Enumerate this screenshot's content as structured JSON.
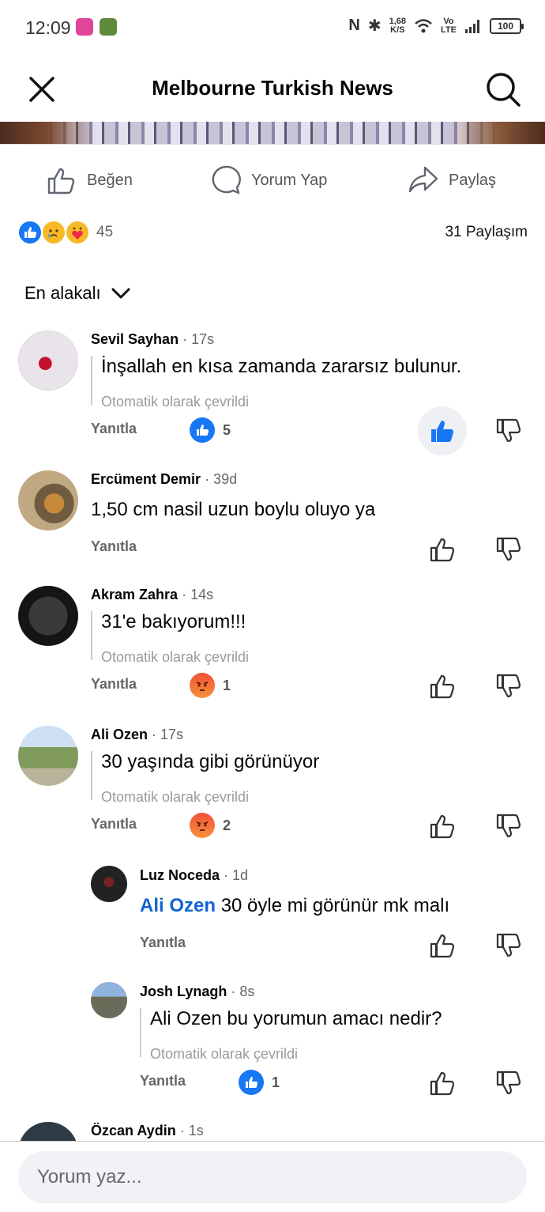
{
  "status_bar": {
    "time": "12:09",
    "net_speed": "1,68",
    "net_unit": "K/S",
    "network_top": "Vo",
    "network_bottom": "LTE",
    "battery": "100"
  },
  "header": {
    "title": "Melbourne Turkish News"
  },
  "actions": {
    "like": "Beğen",
    "comment": "Yorum Yap",
    "share": "Paylaş"
  },
  "stats": {
    "reaction_count": "45",
    "shares": "31 Paylaşım"
  },
  "sort": {
    "label": "En alakalı"
  },
  "comments": [
    {
      "name": "Sevil Sayhan",
      "time": "· 17s",
      "text": "İnşallah en kısa zamanda zararsız bulunur.",
      "translated": "Otomatik olarak çevrildi",
      "reply": "Yanıtla",
      "reaction_count": "5"
    },
    {
      "name": "Ercüment Demir",
      "time": "· 39d",
      "text": "1,50 cm nasil uzun boylu oluyo ya",
      "reply": "Yanıtla"
    },
    {
      "name": "Akram Zahra",
      "time": "· 14s",
      "text": "31'e bakıyorum!!!",
      "translated": "Otomatik olarak çevrildi",
      "reply": "Yanıtla",
      "reaction_count": "1"
    },
    {
      "name": "Ali Ozen",
      "time": "· 17s",
      "text": "30 yaşında gibi görünüyor",
      "translated": "Otomatik olarak çevrildi",
      "reply": "Yanıtla",
      "reaction_count": "2"
    },
    {
      "name": "Luz Noceda",
      "time": "· 1d",
      "mention": "Ali Ozen",
      "text": "30 öyle mi görünür mk malı",
      "reply": "Yanıtla"
    },
    {
      "name": "Josh Lynagh",
      "time": "· 8s",
      "text": "Ali Ozen bu yorumun amacı nedir?",
      "translated": "Otomatik olarak çevrildi",
      "reply": "Yanıtla",
      "reaction_count": "1"
    },
    {
      "name": "Özcan Aydin",
      "time": "· 1s"
    }
  ],
  "composer": {
    "placeholder": "Yorum yaz..."
  },
  "colors": {
    "like_blue": "#1877f2",
    "mention_blue": "#1464d0",
    "angry": "#f0513a"
  }
}
